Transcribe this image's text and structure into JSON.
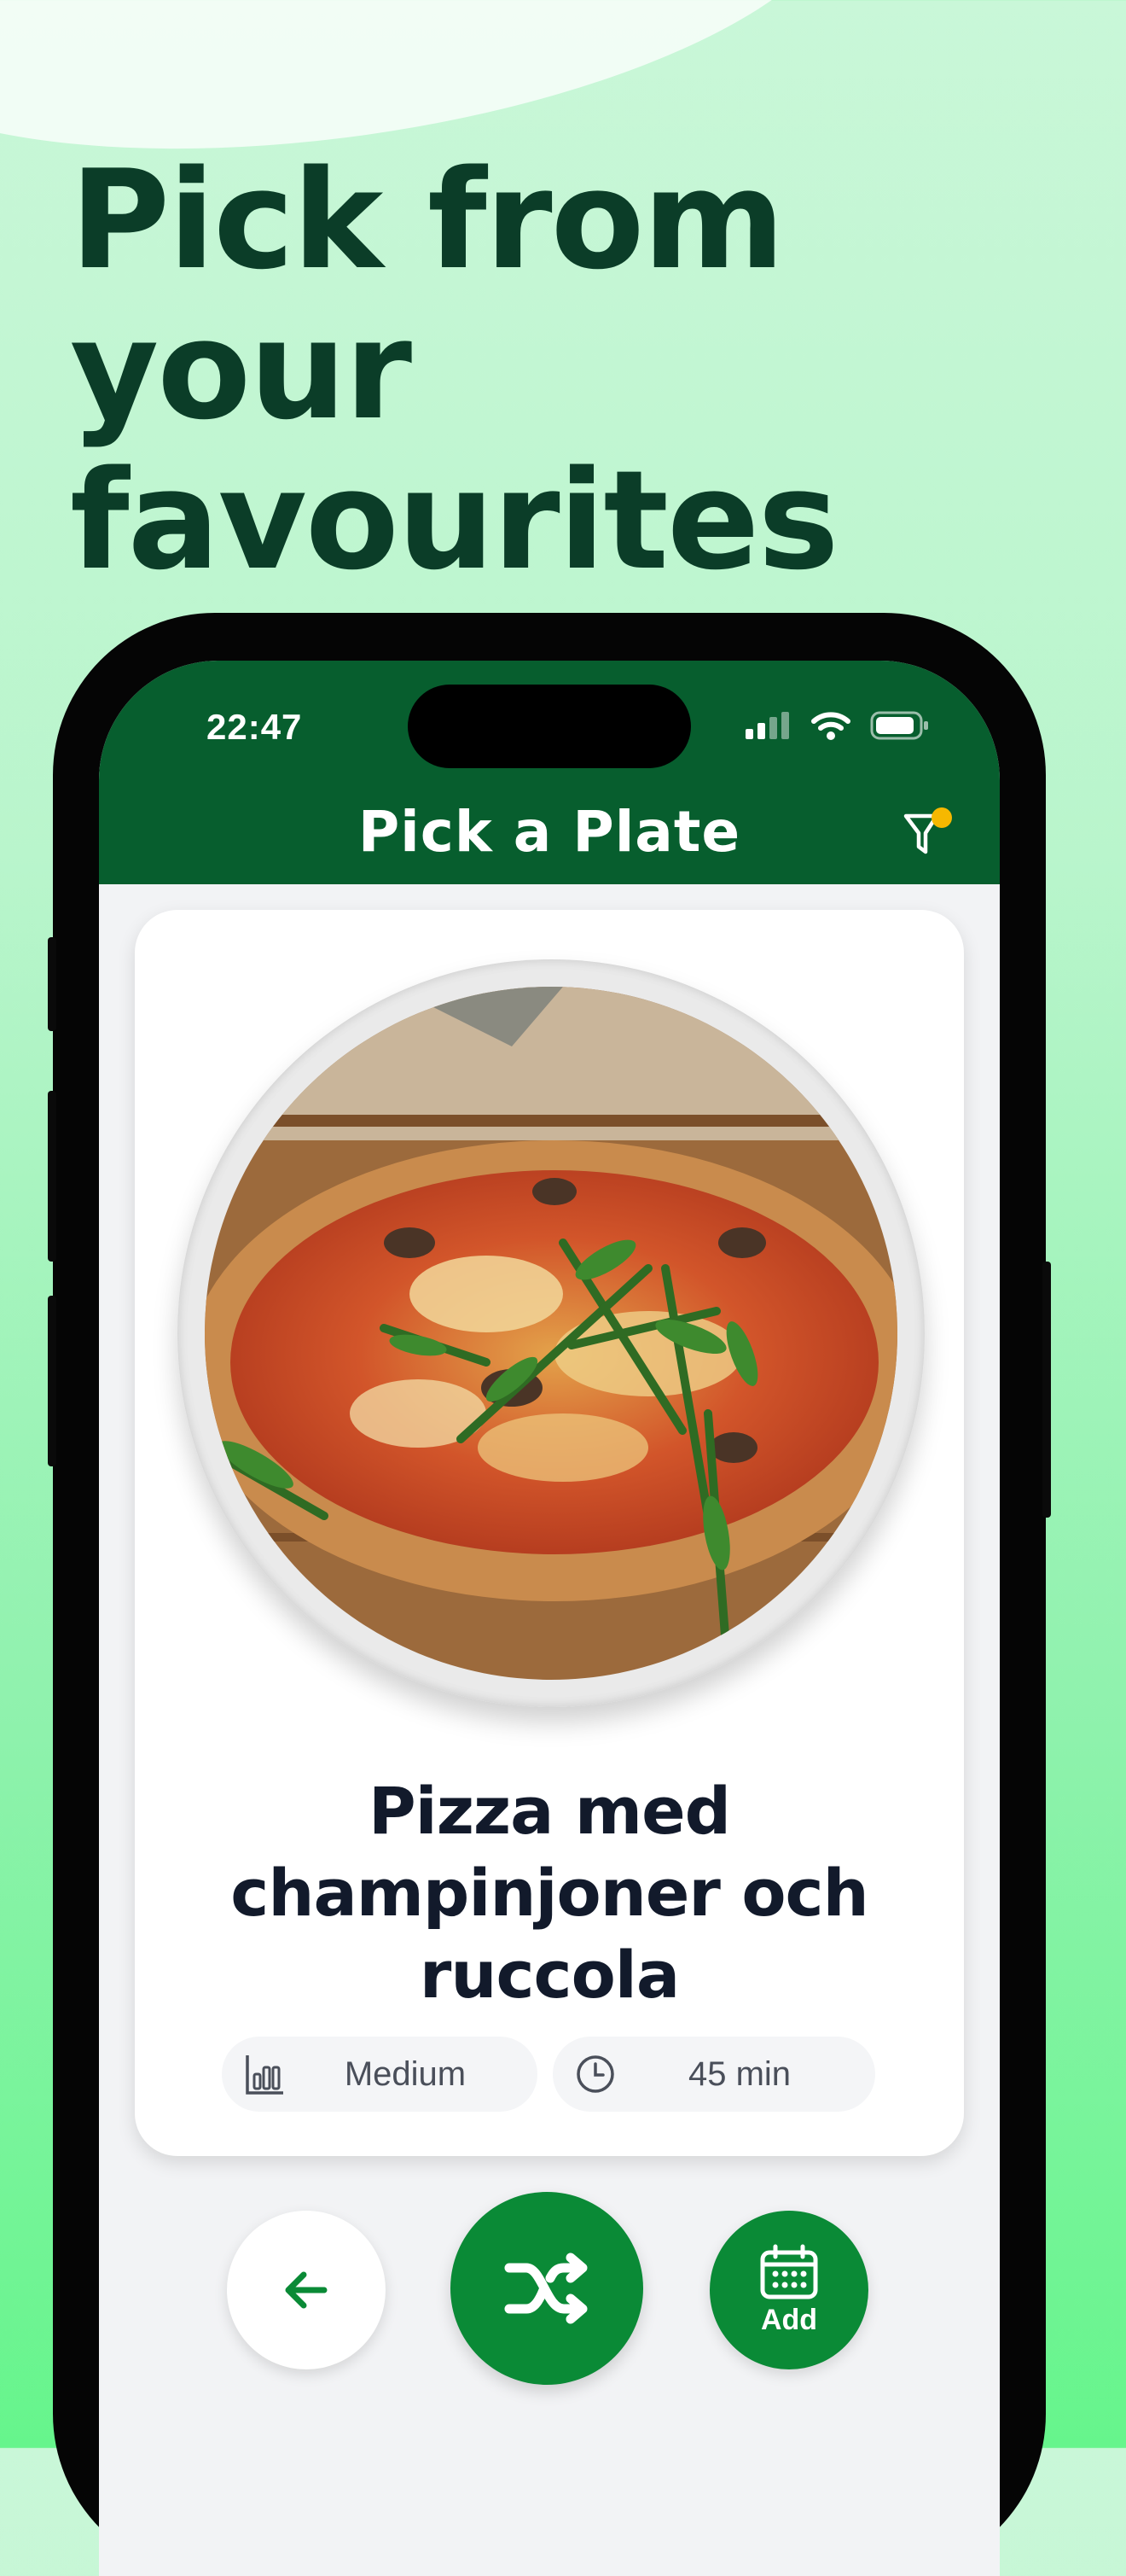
{
  "headline": {
    "line1": "Pick from your",
    "line2": "favourites"
  },
  "status_bar": {
    "time": "22:47"
  },
  "header": {
    "title": "Pick a Plate",
    "filter_icon": "filter-icon",
    "filter_badge_color": "#f6b800"
  },
  "recipe": {
    "title_line1": "Pizza med",
    "title_line2": "champinjoner och",
    "title_line3": "ruccola",
    "difficulty": "Medium",
    "time": "45 min"
  },
  "actions": {
    "back_icon": "arrow-left-icon",
    "shuffle_icon": "shuffle-icon",
    "add_label": "Add",
    "add_icon": "calendar-icon"
  },
  "colors": {
    "header_green": "#075e2e",
    "action_green": "#0a8a36",
    "headline_dark": "#0b3d28"
  }
}
